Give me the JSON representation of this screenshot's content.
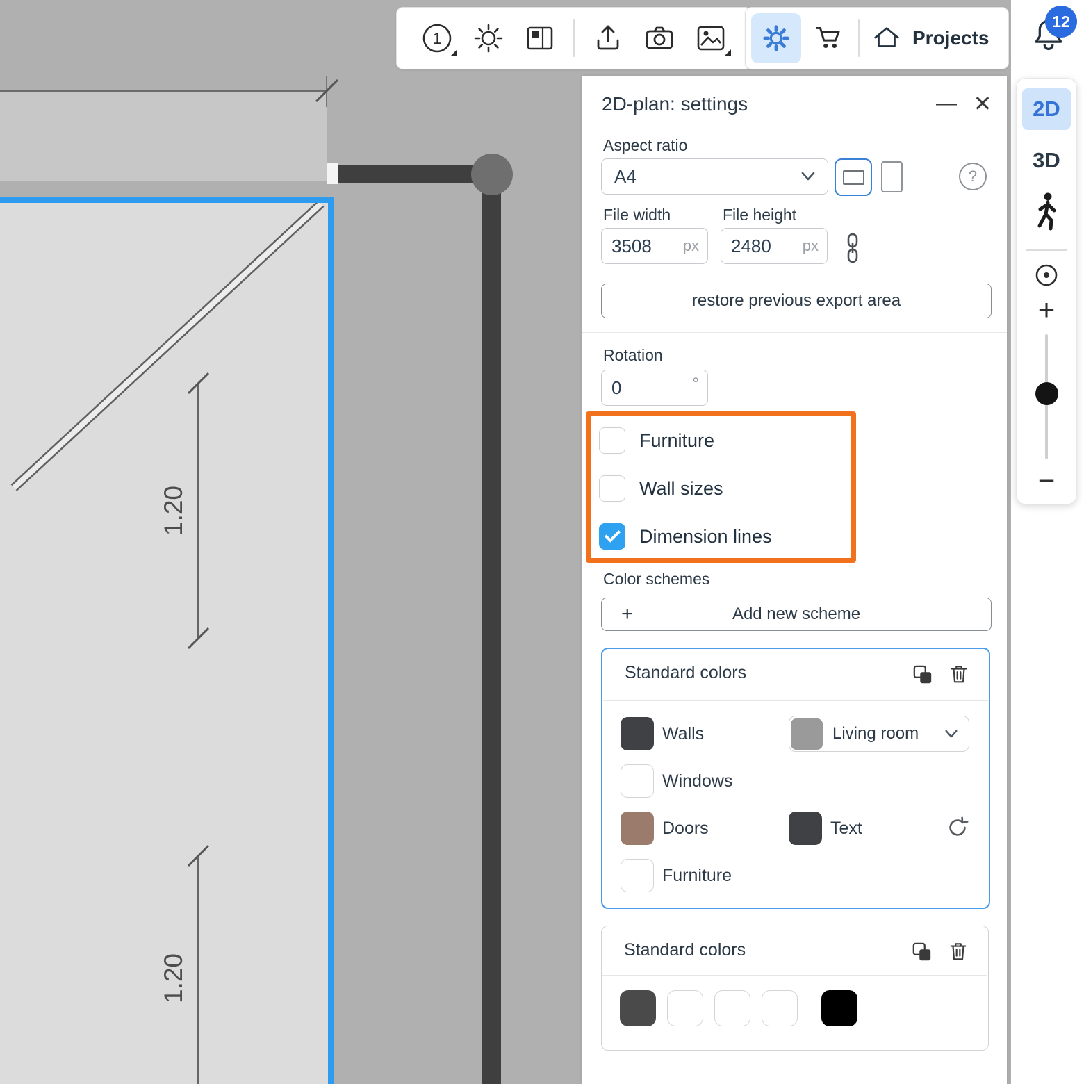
{
  "icons": {
    "close": "✕",
    "minimize": "—",
    "plus": "+",
    "minus": "−",
    "question": "?",
    "layer_number": "1"
  },
  "top_toolbar": {
    "projects_label": "Projects",
    "notification_count": "12"
  },
  "view_panel": {
    "mode_2d": "2D",
    "mode_3d": "3D"
  },
  "settings_panel": {
    "title": "2D-plan: settings",
    "aspect_ratio_label": "Aspect ratio",
    "aspect_ratio_value": "A4",
    "file_width_label": "File width",
    "file_width_value": "3508",
    "file_height_label": "File height",
    "file_height_value": "2480",
    "px_unit": "px",
    "restore_button_label": "restore previous export area",
    "rotation_label": "Rotation",
    "rotation_value": "0",
    "degree_unit": "°",
    "toggles": {
      "furniture": {
        "label": "Furniture",
        "checked": false
      },
      "wall_sizes": {
        "label": "Wall sizes",
        "checked": false
      },
      "dimension_lines": {
        "label": "Dimension lines",
        "checked": true
      }
    },
    "color_schemes_label": "Color schemes",
    "add_scheme_label": "Add new scheme",
    "scheme_active": {
      "title": "Standard colors",
      "walls_label": "Walls",
      "walls_color": "#3f4145",
      "windows_label": "Windows",
      "windows_color": "#ffffff",
      "doors_label": "Doors",
      "doors_color": "#9b7b6b",
      "furniture_label": "Furniture",
      "furniture_color": "#ffffff",
      "text_label": "Text",
      "text_color": "#3f4145",
      "room_value": "Living room",
      "room_color": "#9a9a9a"
    },
    "scheme_secondary": {
      "title": "Standard colors",
      "swatch_colors": [
        "#4a4a4a",
        "#ffffff",
        "#ffffff",
        "#ffffff",
        "#000000"
      ]
    }
  },
  "canvas": {
    "dimension_labels": [
      "1.20",
      "1.20"
    ]
  },
  "theme": {
    "accent_blue": "#2f9bee",
    "selected_bg": "#d6e9fc",
    "annotation_orange": "#f2711c",
    "checkbox_checked": "#2ea1f0",
    "wall_color": "#3f3f3f"
  }
}
